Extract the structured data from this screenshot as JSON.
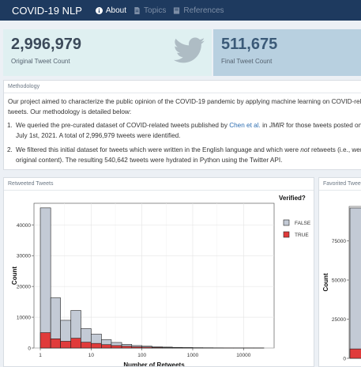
{
  "navbar": {
    "brand": "COVID-19 NLP",
    "items": [
      {
        "label": "About",
        "icon": "info-icon",
        "active": true
      },
      {
        "label": "Topics",
        "icon": "document-icon",
        "active": false
      },
      {
        "label": "References",
        "icon": "book-icon",
        "active": false
      }
    ]
  },
  "value_boxes": [
    {
      "value": "2,996,979",
      "label": "Original Tweet Count",
      "icon": "twitter-icon"
    },
    {
      "value": "511,675",
      "label": "Final Tweet Count"
    }
  ],
  "methodology": {
    "title": "Methodology",
    "intro_1": "Our project aimed to characterize the public opinion of the COVID-19 pandemic by applying machine learning on COVID-relate",
    "intro_2": "tweets. Our methodology is detailed below:",
    "step1": {
      "num": "1.",
      "a": "We queried the pre-curated dataset of COVID-related tweets published by ",
      "link": "Chen et al.",
      "b": " in ",
      "journal": "JMIR",
      "c": " for those tweets posted on",
      "line2": "July 1st, 2021. A total of 2,996,979 tweets were identified."
    },
    "step2": {
      "num": "2.",
      "a": "We filtered this initial dataset for tweets which were written in the English language and which were ",
      "em": "not",
      "b": " retweets (i.e., were",
      "line2": "original content). The resulting 540,642 tweets were hydrated in Python using the Twitter API."
    }
  },
  "retweeted_panel": {
    "title": "Retweeted Tweets"
  },
  "favorited_panel": {
    "title": "Favorited Tweets"
  },
  "chart_data": [
    {
      "type": "bar",
      "title": "",
      "xlabel": "Number of Retweets",
      "ylabel": "Count",
      "x_scale": "log",
      "x_ticks": [
        "1",
        "10",
        "100",
        "1000",
        "10000"
      ],
      "y_ticks": [
        "0",
        "10000",
        "20000",
        "30000",
        "40000"
      ],
      "ylim": [
        0,
        47000
      ],
      "legend": {
        "title": "Verified?",
        "position": "right",
        "entries": [
          "FALSE",
          "TRUE"
        ]
      },
      "colors": {
        "FALSE": "#c3cad5",
        "TRUE": "#e03b3b"
      },
      "bins": [
        1,
        1.6,
        2.5,
        4,
        6.3,
        10,
        16,
        25,
        40,
        63,
        100,
        158,
        251,
        398,
        631,
        1000,
        1585,
        2512,
        3981,
        6310,
        10000,
        15849,
        25119
      ],
      "series": [
        {
          "name": "FALSE",
          "values": [
            45500,
            16300,
            9000,
            12200,
            6300,
            4500,
            2700,
            1800,
            1200,
            800,
            600,
            400,
            300,
            200,
            150,
            100,
            80,
            60,
            50,
            40,
            30,
            20
          ]
        },
        {
          "name": "TRUE",
          "values": [
            5000,
            3000,
            2200,
            3200,
            1900,
            1500,
            1100,
            800,
            600,
            400,
            300,
            200,
            150,
            100,
            80,
            60,
            50,
            40,
            30,
            20,
            15,
            10
          ]
        }
      ]
    },
    {
      "type": "bar",
      "title": "",
      "ylabel": "Count",
      "y_ticks": [
        "0",
        "25000",
        "50000",
        "75000"
      ],
      "ylim": [
        0,
        97000
      ]
    }
  ]
}
